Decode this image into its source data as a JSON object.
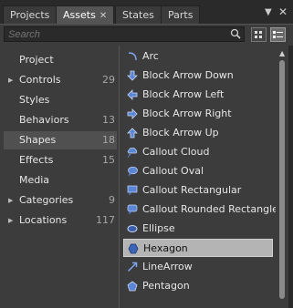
{
  "tabs": [
    {
      "label": "Projects",
      "active": false
    },
    {
      "label": "Assets",
      "active": true,
      "close": "✕"
    },
    {
      "label": "States",
      "active": false
    },
    {
      "label": "Parts",
      "active": false
    }
  ],
  "window_controls": {
    "pin": "▼",
    "close": "✕"
  },
  "search": {
    "placeholder": "Search",
    "value": ""
  },
  "categories": [
    {
      "label": "Project",
      "count": "",
      "expandable": false,
      "selected": false
    },
    {
      "label": "Controls",
      "count": "29",
      "expandable": true,
      "selected": false
    },
    {
      "label": "Styles",
      "count": "",
      "expandable": false,
      "selected": false
    },
    {
      "label": "Behaviors",
      "count": "13",
      "expandable": false,
      "selected": false
    },
    {
      "label": "Shapes",
      "count": "18",
      "expandable": false,
      "selected": true
    },
    {
      "label": "Effects",
      "count": "15",
      "expandable": false,
      "selected": false
    },
    {
      "label": "Media",
      "count": "",
      "expandable": false,
      "selected": false
    },
    {
      "label": "Categories",
      "count": "9",
      "expandable": true,
      "selected": false
    },
    {
      "label": "Locations",
      "count": "117",
      "expandable": true,
      "selected": false
    }
  ],
  "expand_arrow": "▶",
  "shapes": [
    {
      "label": "Arc",
      "icon": "arc-icon"
    },
    {
      "label": "Block Arrow Down",
      "icon": "block-arrow-down-icon"
    },
    {
      "label": "Block Arrow Left",
      "icon": "block-arrow-left-icon"
    },
    {
      "label": "Block Arrow Right",
      "icon": "block-arrow-right-icon"
    },
    {
      "label": "Block Arrow Up",
      "icon": "block-arrow-up-icon"
    },
    {
      "label": "Callout Cloud",
      "icon": "callout-cloud-icon"
    },
    {
      "label": "Callout Oval",
      "icon": "callout-oval-icon"
    },
    {
      "label": "Callout Rectangular",
      "icon": "callout-rectangular-icon"
    },
    {
      "label": "Callout Rounded Rectangle",
      "icon": "callout-rounded-rectangle-icon"
    },
    {
      "label": "Ellipse",
      "icon": "ellipse-icon"
    },
    {
      "label": "Hexagon",
      "icon": "hexagon-icon",
      "selected": true
    },
    {
      "label": "LineArrow",
      "icon": "line-arrow-icon"
    },
    {
      "label": "Pentagon",
      "icon": "pentagon-icon"
    }
  ],
  "colors": {
    "icon_blue": "#5b86d6",
    "selected_item": "#b4b4b4",
    "selected_category": "#505050"
  }
}
